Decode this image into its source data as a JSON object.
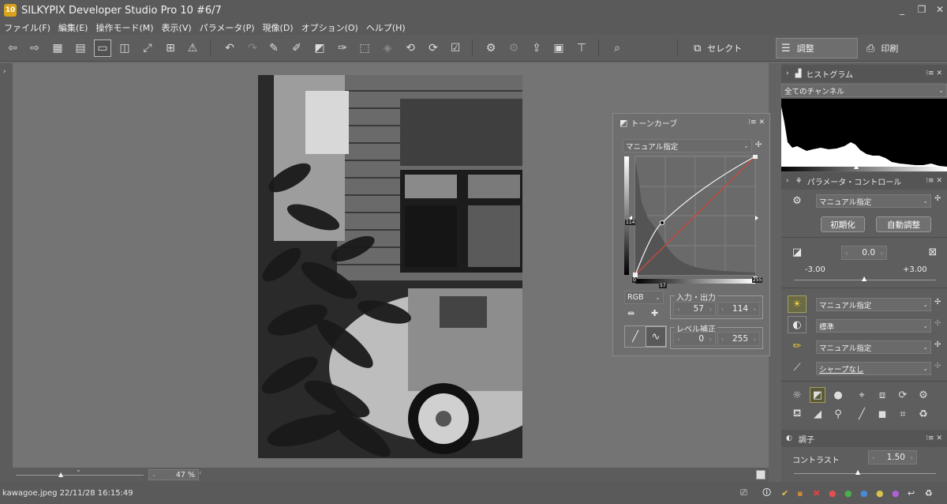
{
  "window": {
    "title": "SILKYPIX Developer Studio Pro 10    #6/7",
    "app_icon": "10",
    "controls": [
      "_",
      "❐",
      "✕"
    ]
  },
  "menu": [
    "ファイル(F)",
    "編集(E)",
    "操作モード(M)",
    "表示(V)",
    "パラメータ(P)",
    "現像(D)",
    "オプション(O)",
    "ヘルプ(H)"
  ],
  "modes": {
    "select": "セレクト",
    "adjust": "調整",
    "print": "印刷"
  },
  "zoom": {
    "value": "47",
    "unit": "%"
  },
  "status": {
    "file": "kawagoe.jpeg 22/11/28 16:15:49"
  },
  "histogram": {
    "title": "ヒストグラム",
    "channel": "全てのチャンネル"
  },
  "param_control": {
    "title": "パラメータ・コントロール",
    "taste": "マニュアル指定",
    "btn_init": "初期化",
    "btn_auto": "自動調整",
    "exposure": "0.0",
    "exp_min": "-3.00",
    "exp_max": "+3.00",
    "wb": "マニュアル指定",
    "tone": "標準",
    "color": "マニュアル指定",
    "sharp": "シャープなし"
  },
  "tone_panel": {
    "title": "調子",
    "contrast_label": "コントラスト",
    "contrast_value": "1.50"
  },
  "tonecurve": {
    "title": "トーンカーブ",
    "preset": "マニュアル指定",
    "channel": "RGB",
    "io_label": "入力・出力",
    "input": "57",
    "output": "114",
    "level_label": "レベル補正",
    "level_low": "0",
    "level_high": "255",
    "ticks": {
      "left": "114",
      "bottom_left": "0",
      "bottom_mid": "57",
      "bottom_right": "255"
    }
  }
}
